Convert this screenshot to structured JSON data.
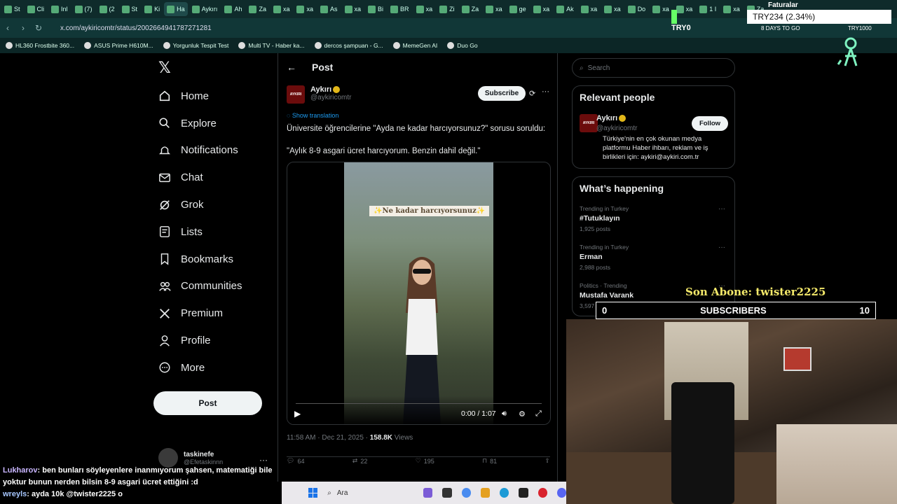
{
  "browser": {
    "tabs": [
      "St",
      "Cli",
      "Inl",
      "(7)",
      "(2",
      "St",
      "Ki",
      "Ha",
      "Aykırı",
      "Ah",
      "Za",
      "xa",
      "xa",
      "As",
      "xa",
      "Bi",
      "BR",
      "xa",
      "Zi",
      "Za",
      "xa",
      "ge",
      "xa",
      "Ak",
      "xa",
      "xa",
      "Do",
      "xa",
      "xa",
      "1 I",
      "xa",
      "Za"
    ],
    "url": "x.com/aykiricomtr/status/2002664941787271281",
    "bookmarks": [
      "HL360 Frostbite 360...",
      "ASUS Prime H610M...",
      "Yorgunluk Tespit Test",
      "Multi TV - Haber ka...",
      "dercos şampuan - G...",
      "MemeGen AI",
      "Duo Go"
    ]
  },
  "overlay": {
    "ticker_label": "Faturalar",
    "ticker": "TRY234 (2.34%)",
    "tryo": "TRY0",
    "days": "8 DAYS TO GO",
    "try_goal": "TRY1000",
    "son_abone": "Son Abone: twister2225",
    "subs_left": "0",
    "subs_title": "SUBSCRIBERS",
    "subs_right": "10"
  },
  "nav": {
    "items": [
      {
        "label": "Home",
        "icon": "home-icon"
      },
      {
        "label": "Explore",
        "icon": "search-icon"
      },
      {
        "label": "Notifications",
        "icon": "bell-icon"
      },
      {
        "label": "Chat",
        "icon": "mail-icon"
      },
      {
        "label": "Grok",
        "icon": "grok-icon"
      },
      {
        "label": "Lists",
        "icon": "list-icon"
      },
      {
        "label": "Bookmarks",
        "icon": "bookmark-icon"
      },
      {
        "label": "Communities",
        "icon": "communities-icon"
      },
      {
        "label": "Premium",
        "icon": "x-icon"
      },
      {
        "label": "Profile",
        "icon": "profile-icon"
      },
      {
        "label": "More",
        "icon": "more-icon"
      }
    ],
    "post_label": "Post",
    "account_name": "taskinefe",
    "account_handle": "@Efetaskinnn"
  },
  "main": {
    "title": "Post",
    "author_name": "Aykırı",
    "author_handle": "@aykiricomtr",
    "logo_text": "AYKIRI",
    "subscribe_label": "Subscribe",
    "show_translation": "Show translation",
    "text1": "Üniversite öğrencilerine \"Ayda ne kadar harcıyorsunuz?\" sorusu soruldu:",
    "text2": "\"Aylık 8-9 asgari ücret harcıyorum. Benzin dahil değil.\"",
    "video_caption": "✨Ne kadar harcıyorsunuz✨",
    "video_time": "0:00 / 1:07",
    "timestamp": "11:58 AM · Dec 21, 2025 · ",
    "views_count": "158.8K",
    "views_label": " Views",
    "replies": "64",
    "reposts": "22",
    "likes": "195",
    "bookmarks": "81"
  },
  "sidebar": {
    "search_placeholder": "Search",
    "relevant_title": "Relevant people",
    "rp_name": "Aykırı",
    "rp_handle": "@aykiricomtr",
    "follow_label": "Follow",
    "rp_bio": "Türkiye'nin en çok okunan medya platformu Haber ihbarı, reklam ve iş birlikleri için: aykiri@aykiri.com.tr",
    "happening_title": "What’s happening",
    "trends": [
      {
        "context": "Trending in Turkey",
        "name": "#Tutuklayın",
        "count": "1,925 posts"
      },
      {
        "context": "Trending in Turkey",
        "name": "Erman",
        "count": "2,988 posts"
      },
      {
        "context": "Politics · Trending",
        "name": "Mustafa Varank",
        "count": "3,597 posts"
      }
    ]
  },
  "chat": {
    "user1": "Lukharov",
    "msg1": ": ben bunları söyleyenlere inanmıyorum şahsen, matematiği bile yoktur bunun nerden bilsin 8-9 asgari ücret ettiğini :d",
    "user2": "wreyls",
    "msg2": ": ayda 10k @twister2225 o"
  },
  "taskbar": {
    "search_placeholder": "Ara"
  }
}
